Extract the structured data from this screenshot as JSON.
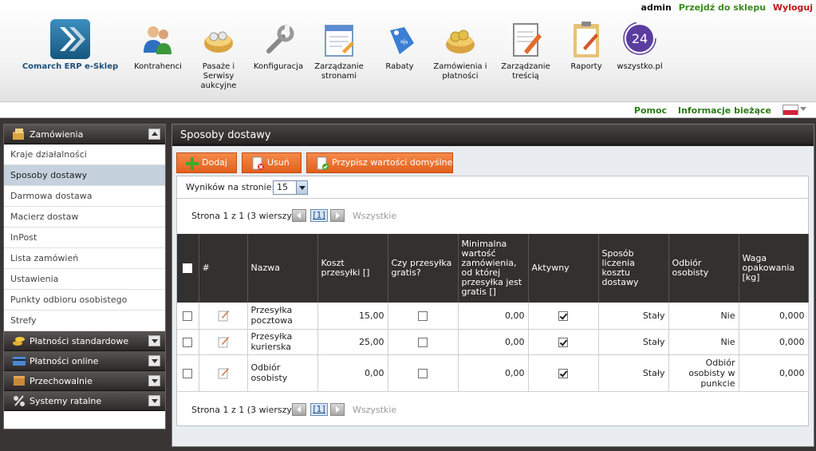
{
  "header": {
    "logo_text": "Comarch ERP e-Sklep",
    "user": "admin",
    "shop_link": "Przejdź do sklepu",
    "logout": "Wyloguj",
    "nav": [
      {
        "label": "Kontrahenci",
        "icon": "contacts-icon"
      },
      {
        "label": "Pasaże i Serwisy aukcyjne",
        "icon": "auctions-basket-icon"
      },
      {
        "label": "Konfiguracja",
        "icon": "wrench-icon"
      },
      {
        "label": "Zarządzanie stronami",
        "icon": "pages-icon"
      },
      {
        "label": "Rabaty",
        "icon": "discount-tag-icon"
      },
      {
        "label": "Zamówienia i płatności",
        "icon": "orders-basket-icon"
      },
      {
        "label": "Zarządzanie treścią",
        "icon": "content-edit-icon"
      },
      {
        "label": "Raporty",
        "icon": "clipboard-icon"
      },
      {
        "label": "wszystko.pl",
        "icon": "wszystko-24-icon",
        "badge": "24"
      }
    ]
  },
  "subbar": {
    "help": "Pomoc",
    "news": "Informacje bieżące"
  },
  "sidebar": {
    "groups": [
      {
        "label": "Zamówienia",
        "icon": "orders-icon"
      },
      {
        "label": "Płatności standardowe",
        "icon": "coins-icon"
      },
      {
        "label": "Płatności online",
        "icon": "card-icon"
      },
      {
        "label": "Przechowalnie",
        "icon": "storage-icon"
      },
      {
        "label": "Systemy ratalne",
        "icon": "percent-icon"
      }
    ],
    "items": [
      "Kraje działalności",
      "Sposoby dostawy",
      "Darmowa dostawa",
      "Macierz dostaw",
      "InPost",
      "Lista zamówień",
      "Ustawienia",
      "Punkty odbioru osobistego",
      "Strefy"
    ],
    "active_item": "Sposoby dostawy"
  },
  "main": {
    "title": "Sposoby dostawy",
    "toolbar": {
      "add": "Dodaj",
      "delete": "Usuń",
      "defaults": "Przypisz wartości domyślne"
    },
    "per_page_label": "Wyników na stronie:",
    "per_page_value": "15",
    "pager": {
      "info": "Strona 1 z 1 (3 wierszy)",
      "page": "[1]",
      "all": "Wszystkie"
    },
    "columns": [
      "#",
      "Nazwa",
      "Koszt przesyłki []",
      "Czy przesyłka gratis?",
      "Minimalna wartość zamówienia, od której przesyłka jest gratis []",
      "Aktywny",
      "Sposób liczenia kosztu dostawy",
      "Odbiór osobisty",
      "Waga opakowania [kg]"
    ],
    "rows": [
      {
        "name": "Przesyłka pocztowa",
        "cost": "15,00",
        "free": false,
        "min_value": "0,00",
        "active": true,
        "calc": "Stały",
        "pickup": "Nie",
        "weight": "0,000"
      },
      {
        "name": "Przesyłka kurierska",
        "cost": "25,00",
        "free": false,
        "min_value": "0,00",
        "active": true,
        "calc": "Stały",
        "pickup": "Nie",
        "weight": "0,000"
      },
      {
        "name": "Odbiór osobisty",
        "cost": "0,00",
        "free": false,
        "min_value": "0,00",
        "active": true,
        "calc": "Stały",
        "pickup": "Odbiór osobisty w punkcie",
        "weight": "0,000"
      }
    ]
  }
}
